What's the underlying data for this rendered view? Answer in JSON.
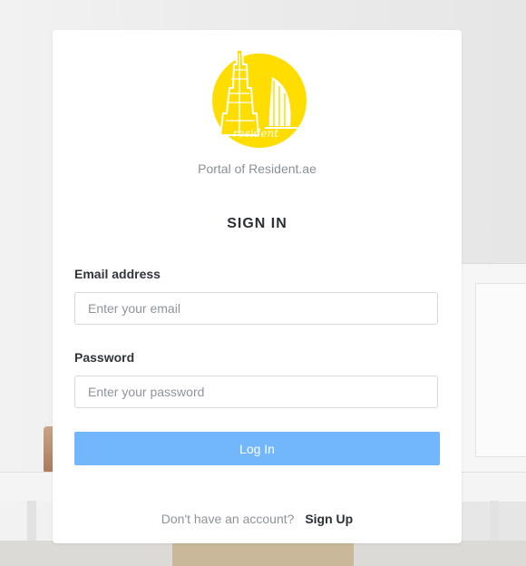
{
  "brand": {
    "logo_text": "resident",
    "logo_color": "#ffdd00",
    "tagline": "Portal of Resident.ae"
  },
  "form": {
    "title": "SIGN IN",
    "email": {
      "label": "Email address",
      "placeholder": "Enter your email",
      "value": ""
    },
    "password": {
      "label": "Password",
      "placeholder": "Enter your password",
      "value": ""
    },
    "submit_label": "Log In",
    "submit_color": "#72b6fb"
  },
  "footer": {
    "question": "Don't have an account?",
    "signup_label": "Sign Up"
  }
}
